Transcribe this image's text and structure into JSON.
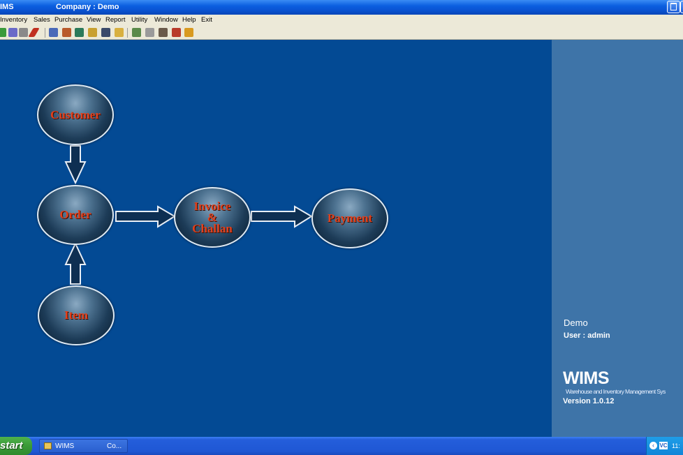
{
  "window": {
    "app_title": "IMS",
    "company_title": "Company : Demo"
  },
  "menu": {
    "items": [
      "Inventory",
      "Sales",
      "Purchase",
      "View",
      "Report",
      "Utility",
      "Window",
      "Help",
      "Exit"
    ]
  },
  "toolbar": {
    "icons": [
      "user-icon",
      "cart-icon",
      "calculator-icon",
      "pen-icon",
      "list-icon",
      "table-icon",
      "bird-icon",
      "chart-icon",
      "box-icon",
      "document-icon",
      "grid-icon",
      "clipboard-icon",
      "building-icon",
      "truck-icon",
      "package-icon"
    ],
    "colors": {
      "accent": "#c03020",
      "panel": "#ece9d8"
    }
  },
  "flow": {
    "customer": "Customer",
    "order": "Order",
    "invoice_line1": "Invoice",
    "invoice_line2": "&",
    "invoice_line3": "Challan",
    "payment": "Payment",
    "item": "Item"
  },
  "side": {
    "company": "Demo",
    "user": "User : admin",
    "logo": "WIMS",
    "fullname": "Warehouse and Inventory Management Sys",
    "version": "Version 1.0.12"
  },
  "taskbar": {
    "start": "start",
    "task_label": "WIMS",
    "task_label2": "Co...",
    "tray_app": "VC",
    "clock": "11:"
  },
  "colors": {
    "main_bg": "#034a94",
    "side_bg": "#3e74a8",
    "node_text": "#e2401c"
  }
}
